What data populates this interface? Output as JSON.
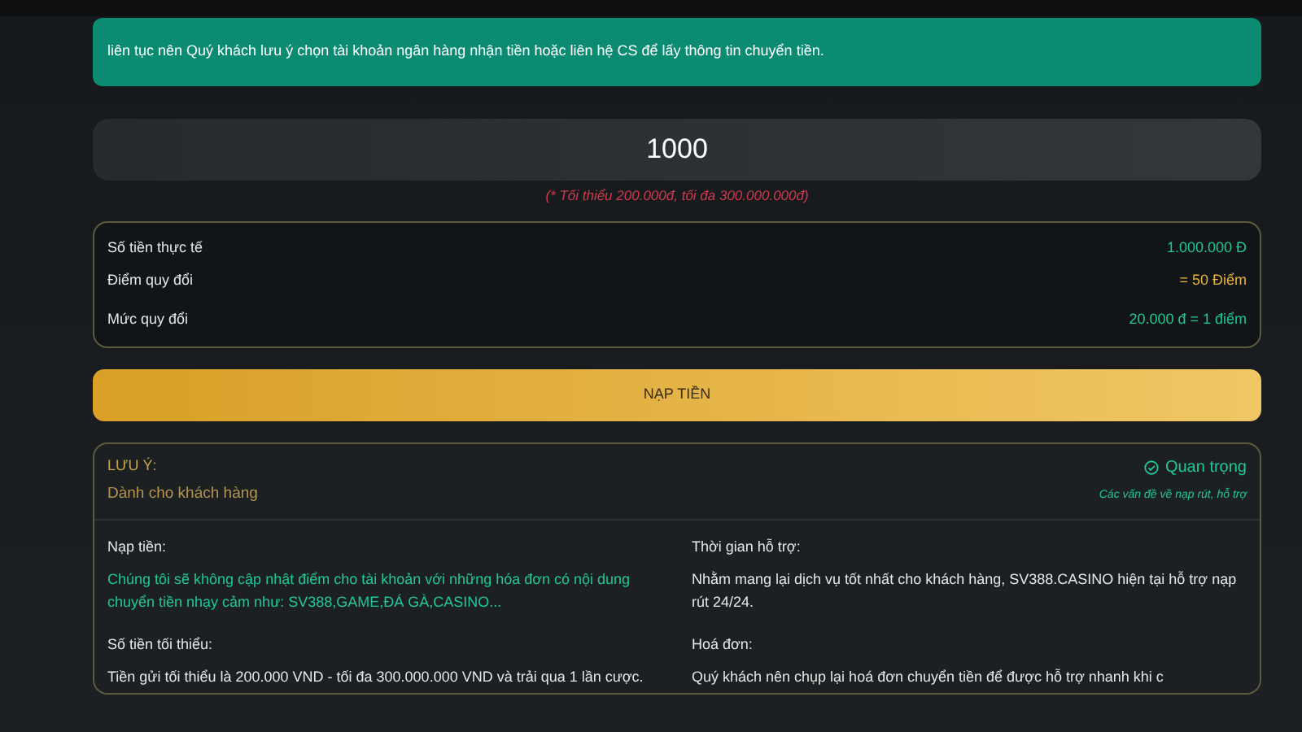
{
  "notice": "liên tục nên Quý khách lưu ý chọn tài khoản ngân hàng nhận tiền hoặc liên hệ CS để lấy thông tin chuyển tiền.",
  "amount_field": {
    "value": "1000",
    "hint": "(* Tối thiểu 200.000đ, tối đa 300.000.000đ)"
  },
  "summary": [
    {
      "label": "Số tiền thực tế",
      "value": "1.000.000 Đ",
      "color": "#1fc79a"
    },
    {
      "label": "Điểm quy đổi",
      "value": "= 50 Điểm",
      "color": "#e8b33f"
    },
    {
      "label": "Mức quy đổi",
      "value": "20.000 đ = 1 điểm",
      "color": "#1fc79a"
    }
  ],
  "submit_button": "NẠP TIỀN",
  "note": {
    "title": "LƯU Ý:",
    "subtitle": "Dành cho khách hàng",
    "badge": "Quan trọng",
    "badge_caption": "Các vấn đề về nạp rút, hỗ trợ",
    "sections": [
      {
        "heading": "Nạp tiền:",
        "body": "Chúng tôi sẽ không cập nhật điểm cho tài khoản với những hóa đơn có nội dung chuyển tiền nhạy cảm như: SV388,GAME,ĐÁ GÀ,CASINO...",
        "color": "#1fc79a"
      },
      {
        "heading": "Thời gian hỗ trợ:",
        "body": "Nhằm mang lại dịch vụ tốt nhất cho khách hàng, SV388.CASINO hiện tại hỗ trợ nạp rút 24/24.",
        "color": "#e6e6e6"
      },
      {
        "heading": "Số tiền tối thiểu:",
        "body": "Tiền gửi tối thiểu là 200.000 VND - tối đa 300.000.000 VND và trải qua 1 lần cược.",
        "color": "#e6e6e6"
      },
      {
        "heading": "Hoá đơn:",
        "body": "Quý khách nên chụp lại hoá đơn chuyển tiền để được hỗ trợ nhanh khi c",
        "color": "#e6e6e6"
      }
    ]
  }
}
